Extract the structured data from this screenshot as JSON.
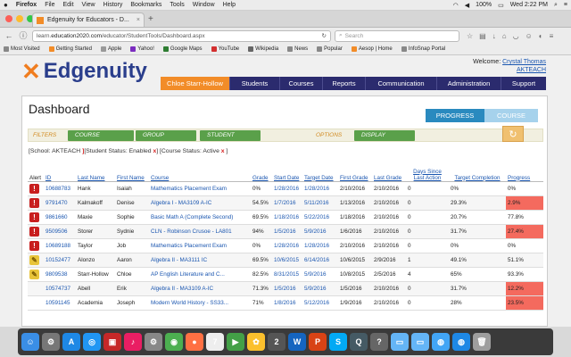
{
  "menubar": {
    "apple": "",
    "app": "Firefox",
    "items": [
      "File",
      "Edit",
      "View",
      "History",
      "Bookmarks",
      "Tools",
      "Window",
      "Help"
    ],
    "battery": "100%",
    "clock": "Wed 2:22 PM"
  },
  "tab": {
    "title": "Edgenuity for Educators - D..."
  },
  "nav": {
    "url_prefix": "learn.",
    "url_domain": "education2020.com",
    "url_path": "/educator/StudentTools/Dashboard.aspx",
    "search_placeholder": "Search"
  },
  "bookmarks": [
    {
      "label": "Most Visited",
      "color": "#888"
    },
    {
      "label": "Getting Started",
      "color": "#f28c28"
    },
    {
      "label": "Apple",
      "color": "#999"
    },
    {
      "label": "Yahoo!",
      "color": "#7b2cbf"
    },
    {
      "label": "Google Maps",
      "color": "#2e7d32"
    },
    {
      "label": "YouTube",
      "color": "#d32f2f"
    },
    {
      "label": "Wikipedia",
      "color": "#666"
    },
    {
      "label": "News",
      "color": "#888"
    },
    {
      "label": "Popular",
      "color": "#888"
    },
    {
      "label": "Aesop | Home",
      "color": "#f28c28"
    },
    {
      "label": "InfoSnap Portal",
      "color": "#888"
    }
  ],
  "header": {
    "logo_text": "Edgenuity",
    "welcome_label": "Welcome:",
    "user": "Crystal Thomas",
    "school": "AKTEACH"
  },
  "mainnav": {
    "student": "Chloe Starr-Hollow",
    "items": [
      "Students",
      "Courses",
      "Reports",
      "Communication",
      "Administration",
      "Support"
    ]
  },
  "dashboard": {
    "title": "Dashboard",
    "tabs": {
      "progress": "PROGRESS",
      "course": "COURSE"
    },
    "filters_label": "FILTERS",
    "options_label": "OPTIONS",
    "buttons": {
      "course": "COURSE",
      "group": "GROUP",
      "student": "STUDENT",
      "display": "DISPLAY"
    },
    "refresh_icon": "refresh-icon",
    "criteria": [
      {
        "text": "[School: AKTEACH ",
        "x": "]"
      },
      {
        "text": "[Student Status: Enabled ",
        "x": "x"
      },
      {
        "text": "] [Course Status: Active ",
        "x": "x"
      },
      {
        "text": " ]",
        "x": ""
      }
    ]
  },
  "table": {
    "headers": [
      "Alert",
      "ID",
      "Last Name",
      "First Name",
      "Course",
      "Grade",
      "Start Date",
      "Target Date",
      "First Grade",
      "Last Grade",
      "Days Since Last Action",
      "Target Completion",
      "Progress"
    ],
    "rows": [
      {
        "alert": "red",
        "id": "10688783",
        "last": "Hank",
        "first": "Isaiah",
        "course": "Mathematics Placement Exam",
        "grade": "0%",
        "start": "1/28/2016",
        "target": "1/28/2016",
        "first_grade": "2/10/2016",
        "last_grade": "2/10/2016",
        "days": "0",
        "completion": "0%",
        "progress": "0%",
        "prog_flag": false
      },
      {
        "alert": "red",
        "id": "9791470",
        "last": "Kalmakoff",
        "first": "Denise",
        "course": "Algebra I - MA3109 A-IC",
        "grade": "54.5%",
        "start": "1/7/2016",
        "target": "5/11/2016",
        "first_grade": "1/13/2016",
        "last_grade": "2/10/2016",
        "days": "0",
        "completion": "29.3%",
        "progress": "2.9%",
        "prog_flag": true
      },
      {
        "alert": "red",
        "id": "9861660",
        "last": "Maxie",
        "first": "Sophie",
        "course": "Basic Math A (Complete Second)",
        "grade": "69.5%",
        "start": "1/18/2016",
        "target": "5/22/2016",
        "first_grade": "1/18/2016",
        "last_grade": "2/10/2016",
        "days": "0",
        "completion": "20.7%",
        "progress": "77.8%",
        "prog_flag": false
      },
      {
        "alert": "red",
        "id": "9509506",
        "last": "Storer",
        "first": "Sydnie",
        "course": "CLN - Robinson Crusoe - LA801",
        "grade": "94%",
        "start": "1/5/2016",
        "target": "5/9/2016",
        "first_grade": "1/6/2016",
        "last_grade": "2/10/2016",
        "days": "0",
        "completion": "31.7%",
        "progress": "27.4%",
        "prog_flag": true
      },
      {
        "alert": "red",
        "id": "10689188",
        "last": "Taylor",
        "first": "Job",
        "course": "Mathematics Placement Exam",
        "grade": "0%",
        "start": "1/28/2016",
        "target": "1/28/2016",
        "first_grade": "2/10/2016",
        "last_grade": "2/10/2016",
        "days": "0",
        "completion": "0%",
        "progress": "0%",
        "prog_flag": false
      },
      {
        "alert": "yel",
        "id": "10152477",
        "last": "Alonzo",
        "first": "Aaron",
        "course": "Algebra II - MA3111 IC",
        "grade": "69.5%",
        "start": "10/6/2015",
        "target": "6/14/2016",
        "first_grade": "10/6/2015",
        "last_grade": "2/9/2016",
        "days": "1",
        "completion": "49.1%",
        "progress": "51.1%",
        "prog_flag": false
      },
      {
        "alert": "yel",
        "id": "9809538",
        "last": "Starr-Hollow",
        "first": "Chloe",
        "course": "AP English Literature and C...",
        "grade": "82.5%",
        "start": "8/31/2015",
        "target": "5/9/2016",
        "first_grade": "10/8/2015",
        "last_grade": "2/5/2016",
        "days": "4",
        "completion": "65%",
        "progress": "93.3%",
        "prog_flag": false
      },
      {
        "alert": "",
        "id": "10574737",
        "last": "Abell",
        "first": "Erik",
        "course": "Algebra II - MA3109 A-IC",
        "grade": "71.3%",
        "start": "1/5/2016",
        "target": "5/9/2016",
        "first_grade": "1/5/2016",
        "last_grade": "2/10/2016",
        "days": "0",
        "completion": "31.7%",
        "progress": "12.2%",
        "prog_flag": true
      },
      {
        "alert": "",
        "id": "10591145",
        "last": "Academia",
        "first": "Joseph",
        "course": "Modern World History - SS33...",
        "grade": "71%",
        "start": "1/8/2016",
        "target": "5/12/2016",
        "first_grade": "1/9/2016",
        "last_grade": "2/10/2016",
        "days": "0",
        "completion": "28%",
        "progress": "23.5%",
        "prog_flag": true
      }
    ]
  },
  "dock": [
    {
      "name": "finder-icon",
      "color": "#3a8ee6",
      "glyph": "☺"
    },
    {
      "name": "launchpad-icon",
      "color": "#777",
      "glyph": "⚙"
    },
    {
      "name": "app-store-icon",
      "color": "#1e88e5",
      "glyph": "A"
    },
    {
      "name": "safari-icon",
      "color": "#2196f3",
      "glyph": "◎"
    },
    {
      "name": "photo-booth-icon",
      "color": "#c62828",
      "glyph": "▣"
    },
    {
      "name": "itunes-icon",
      "color": "#e91e63",
      "glyph": "♪"
    },
    {
      "name": "system-preferences-icon",
      "color": "#888",
      "glyph": "⚙"
    },
    {
      "name": "chrome-icon",
      "color": "#4caf50",
      "glyph": "◉"
    },
    {
      "name": "firefox-icon",
      "color": "#ff7043",
      "glyph": "●"
    },
    {
      "name": "calendar-icon",
      "color": "#eee",
      "glyph": "7"
    },
    {
      "name": "facetime-icon",
      "color": "#43a047",
      "glyph": "▶"
    },
    {
      "name": "photos-icon",
      "color": "#fbc02d",
      "glyph": "✿"
    },
    {
      "name": "stopwatch-icon",
      "color": "#555",
      "glyph": "2"
    },
    {
      "name": "word-icon",
      "color": "#1565c0",
      "glyph": "W"
    },
    {
      "name": "powerpoint-icon",
      "color": "#d84315",
      "glyph": "P"
    },
    {
      "name": "skype-icon",
      "color": "#03a9f4",
      "glyph": "S"
    },
    {
      "name": "search-app-icon",
      "color": "#455a64",
      "glyph": "Q"
    },
    {
      "name": "help-icon",
      "color": "#666",
      "glyph": "?"
    },
    {
      "name": "folder-icon",
      "color": "#64b5f6",
      "glyph": "▭"
    },
    {
      "name": "folder-icon-2",
      "color": "#64b5f6",
      "glyph": "▭"
    },
    {
      "name": "globe-icon",
      "color": "#42a5f5",
      "glyph": "◍"
    },
    {
      "name": "downloads-icon",
      "color": "#1e88e5",
      "glyph": "◍"
    },
    {
      "name": "trash-icon",
      "color": "#9e9e9e",
      "glyph": "🗑"
    }
  ],
  "colors": {
    "accent": "#f28c28",
    "nav": "#2b2b6e",
    "link": "#1a56b0",
    "alert_red": "#c81e1e",
    "progress_low": "#f46a5e"
  }
}
